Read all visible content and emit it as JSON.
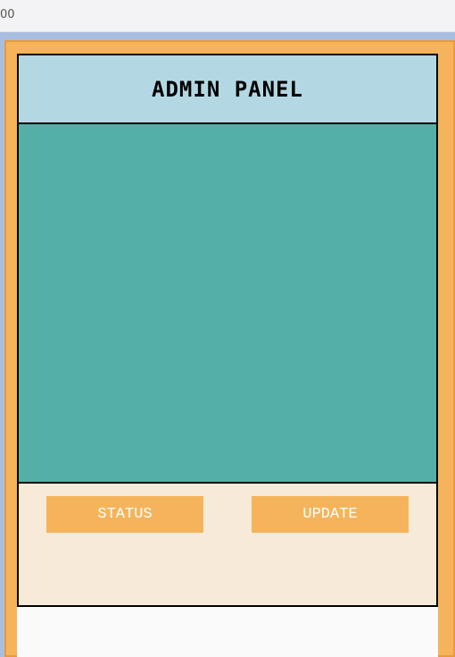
{
  "browser": {
    "url_fragment": "00"
  },
  "panel": {
    "title": "ADMIN PANEL",
    "buttons": {
      "status_label": "STATUS",
      "update_label": "UPDATE"
    }
  },
  "colors": {
    "frame": "#f5b45b",
    "header": "#b4d8e3",
    "content": "#54afa8",
    "footer": "#f7ead8",
    "button": "#f5b45b"
  }
}
